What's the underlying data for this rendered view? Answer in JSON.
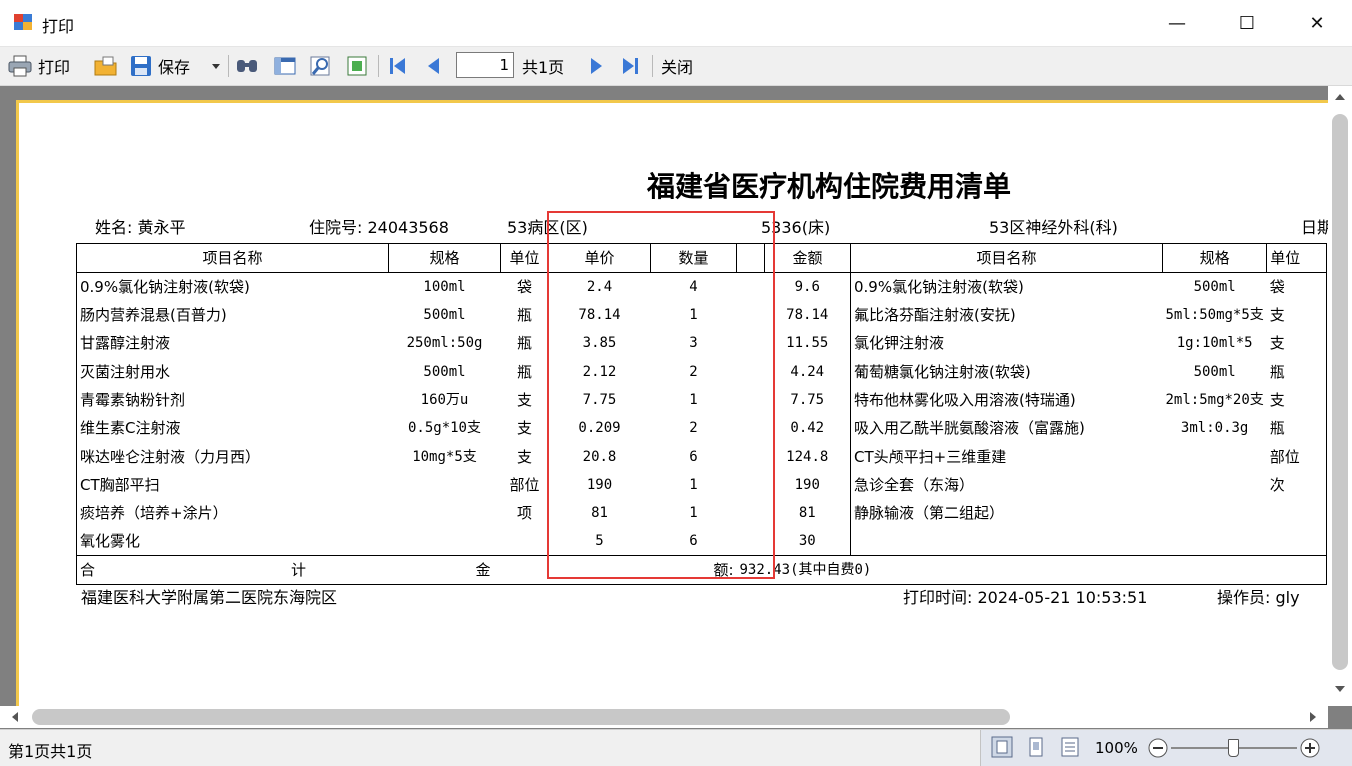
{
  "window": {
    "title": "打印",
    "minimize_glyph": "—",
    "maximize_glyph": "☐",
    "close_glyph": "✕"
  },
  "toolbar": {
    "print_label": "打印",
    "save_label": "保存",
    "page_value": "1",
    "page_total": "共1页",
    "close_label": "关闭",
    "icons": [
      "printer-icon",
      "open-folder-icon",
      "save-icon",
      "dropdown-arrow-icon",
      "find-icon",
      "thumbnail-icon",
      "zoom-icon",
      "page-setup-icon",
      "first-page-icon",
      "prev-page-icon",
      "next-page-icon",
      "last-page-icon"
    ]
  },
  "report": {
    "title": "福建省医疗机构住院费用清单",
    "name_label": "姓名: 黄永平",
    "admission_label": "住院号: 24043568",
    "ward_label": "53病区(区)",
    "bed_label": "5336(床)",
    "dept_label": "53区神经外科(科)",
    "date_label": "日期",
    "headers": {
      "left": [
        "项目名称",
        "规格",
        "单位",
        "单价",
        "数量",
        "",
        "金额"
      ],
      "right": [
        "项目名称",
        "规格",
        "单位"
      ]
    },
    "rows": [
      {
        "name": "0.9%氯化钠注射液(软袋)",
        "spec": "100ml",
        "unit": "袋",
        "price": "2.4",
        "qty": "4",
        "amount": "9.6",
        "r_name": "0.9%氯化钠注射液(软袋)",
        "r_spec": "500ml",
        "r_unit": "袋"
      },
      {
        "name": "肠内营养混悬(百普力)",
        "spec": "500ml",
        "unit": "瓶",
        "price": "78.14",
        "qty": "1",
        "amount": "78.14",
        "r_name": "氟比洛芬酯注射液(安抚)",
        "r_spec": "5ml:50mg*5支",
        "r_unit": "支"
      },
      {
        "name": "甘露醇注射液",
        "spec": "250ml:50g",
        "unit": "瓶",
        "price": "3.85",
        "qty": "3",
        "amount": "11.55",
        "r_name": "氯化钾注射液",
        "r_spec": "1g:10ml*5",
        "r_unit": "支"
      },
      {
        "name": "灭菌注射用水",
        "spec": "500ml",
        "unit": "瓶",
        "price": "2.12",
        "qty": "2",
        "amount": "4.24",
        "r_name": "葡萄糖氯化钠注射液(软袋)",
        "r_spec": "500ml",
        "r_unit": "瓶"
      },
      {
        "name": "青霉素钠粉针剂",
        "spec": "160万u",
        "unit": "支",
        "price": "7.75",
        "qty": "1",
        "amount": "7.75",
        "r_name": "特布他林雾化吸入用溶液(特瑞通)",
        "r_spec": "2ml:5mg*20支",
        "r_unit": "支"
      },
      {
        "name": "维生素C注射液",
        "spec": "0.5g*10支",
        "unit": "支",
        "price": "0.209",
        "qty": "2",
        "amount": "0.42",
        "r_name": "吸入用乙酰半胱氨酸溶液（富露施)",
        "r_spec": "3ml:0.3g",
        "r_unit": "瓶"
      },
      {
        "name": "咪达唑仑注射液（力月西）",
        "spec": "10mg*5支",
        "unit": "支",
        "price": "20.8",
        "qty": "6",
        "amount": "124.8",
        "r_name": "CT头颅平扫+三维重建",
        "r_spec": "",
        "r_unit": "部位"
      },
      {
        "name": "CT胸部平扫",
        "spec": "",
        "unit": "部位",
        "price": "190",
        "qty": "1",
        "amount": "190",
        "r_name": "急诊全套（东海）",
        "r_spec": "",
        "r_unit": "次"
      },
      {
        "name": "痰培养（培养+涂片）",
        "spec": "",
        "unit": "项",
        "price": "81",
        "qty": "1",
        "amount": "81",
        "r_name": "静脉输液（第二组起）",
        "r_spec": "",
        "r_unit": ""
      },
      {
        "name": "氧化雾化",
        "spec": "",
        "unit": "",
        "price": "5",
        "qty": "6",
        "amount": "30",
        "r_name": "",
        "r_spec": "",
        "r_unit": ""
      }
    ],
    "sum": {
      "he": "合",
      "ji": "计",
      "jin": "金",
      "e": "额:",
      "value": "932.43(其中自费0)"
    },
    "hospital": "福建医科大学附属第二医院东海院区",
    "print_time": "打印时间: 2024-05-21  10:53:51",
    "operator": "操作员: gly"
  },
  "status": {
    "page_info": "第1页共1页",
    "zoom": "100%"
  },
  "colors": {
    "highlight_box": "#e53935",
    "paper_border": "#f2c84b",
    "viewer_bg": "#808080"
  }
}
